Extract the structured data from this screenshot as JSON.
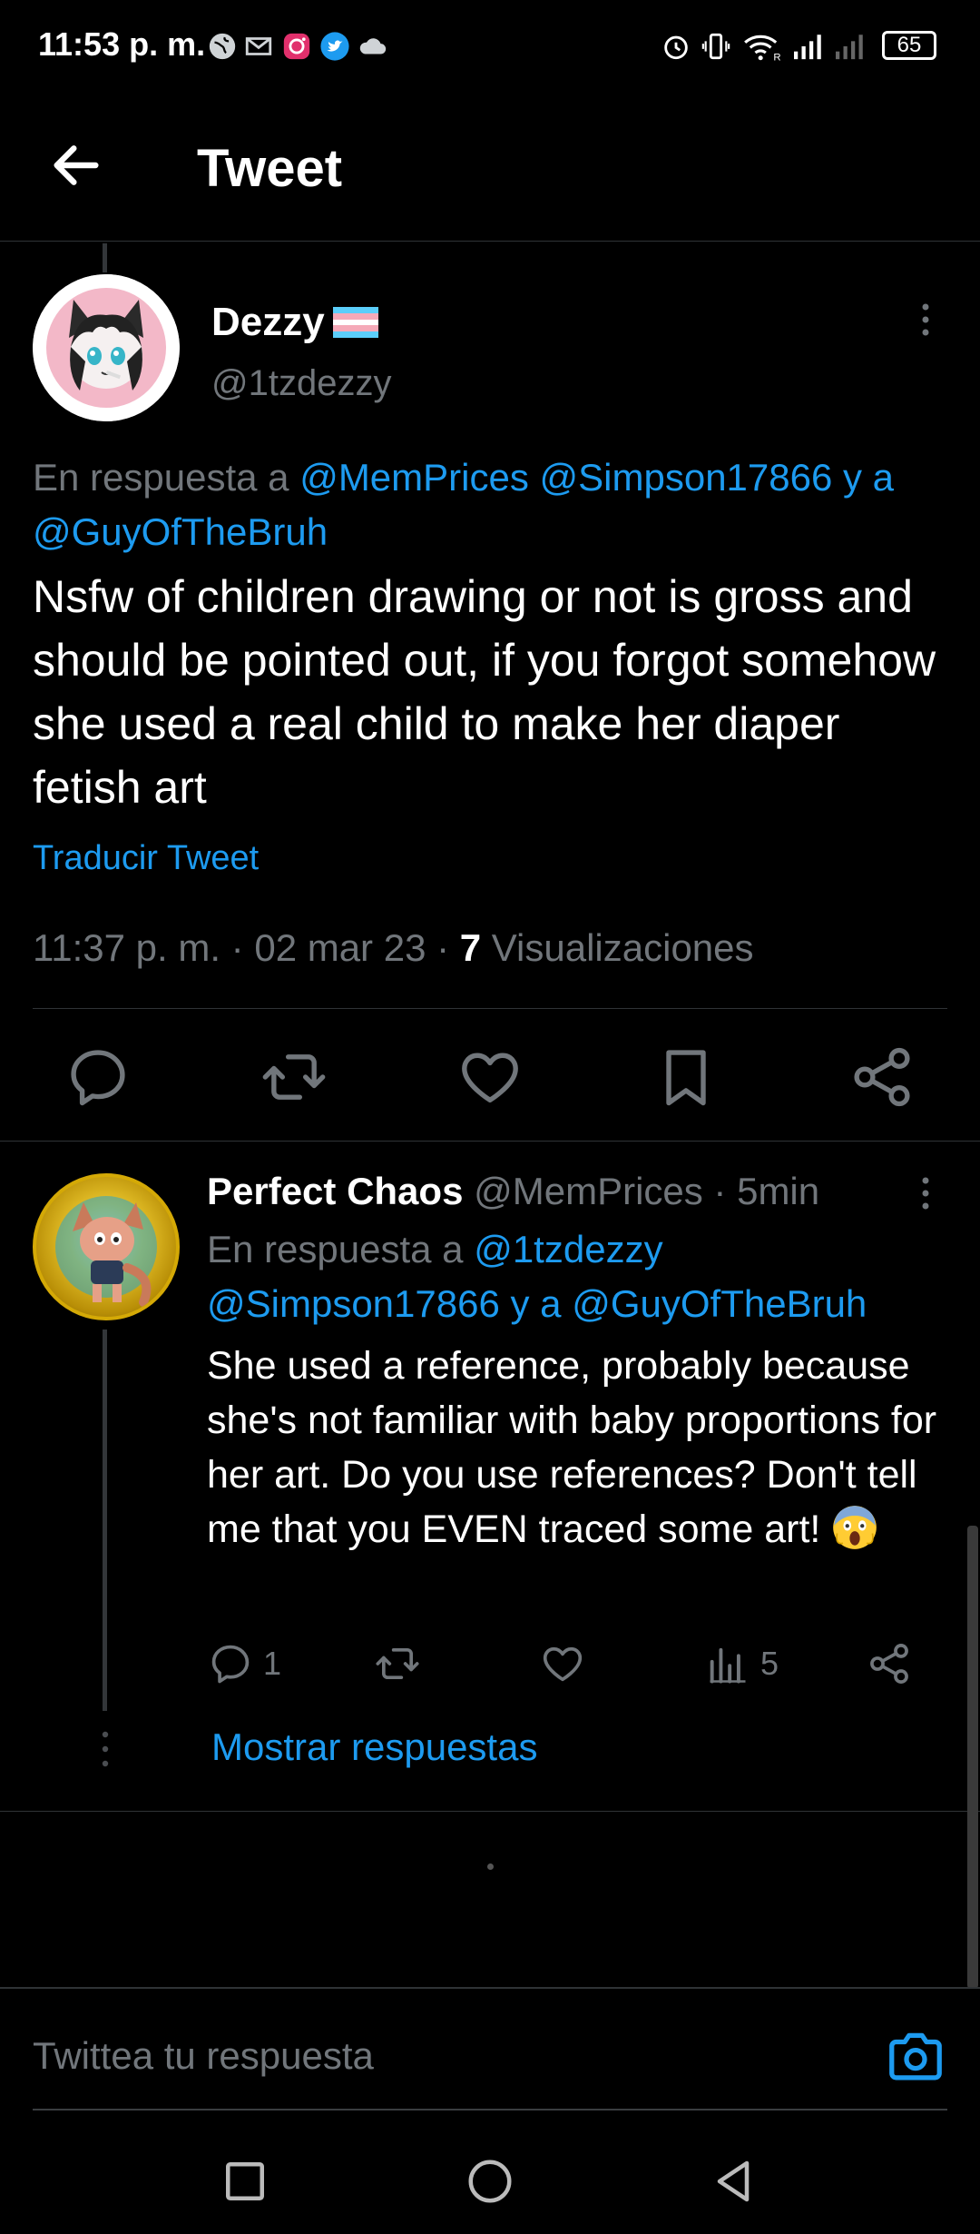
{
  "status_bar": {
    "time": "11:53 p. m.",
    "battery": "65"
  },
  "header": {
    "title": "Tweet",
    "back_icon": "arrow-left-icon"
  },
  "main_tweet": {
    "name": "Dezzy",
    "flag_icon": "trans-flag-icon",
    "handle": "@1tzdezzy",
    "reply_prefix": "En respuesta a",
    "reply_mentions": "@MemPrices @Simpson17866 y a @GuyOfTheBruh",
    "text": "Nsfw of children drawing or not is gross and should be pointed out, if you forgot somehow she used a real child to make her diaper fetish art",
    "translate": "Traducir Tweet",
    "time_date": "11:37 p. m. · 02 mar 23 · ",
    "views_count": "7",
    "views_label": " Visualizaciones"
  },
  "reply_tweet": {
    "name": "Perfect Chaos",
    "handle_time": " @MemPrices · 5min",
    "reply_prefix": "En respuesta a ",
    "reply_mentions": "@1tzdezzy @Simpson17866 y a @GuyOfTheBruh",
    "text": "She used a reference, probably because she's not familiar with baby proportions for her art. Do you use references? Don't tell me that you EVEN traced some art! ",
    "emoji": "face-screaming-icon",
    "reply_count": "1",
    "views_count": "5",
    "show_replies": "Mostrar respuestas"
  },
  "compose": {
    "placeholder": "Twittea tu respuesta"
  },
  "colors": {
    "accent": "#1d9bf0",
    "muted": "#71767b",
    "background": "#000000"
  }
}
